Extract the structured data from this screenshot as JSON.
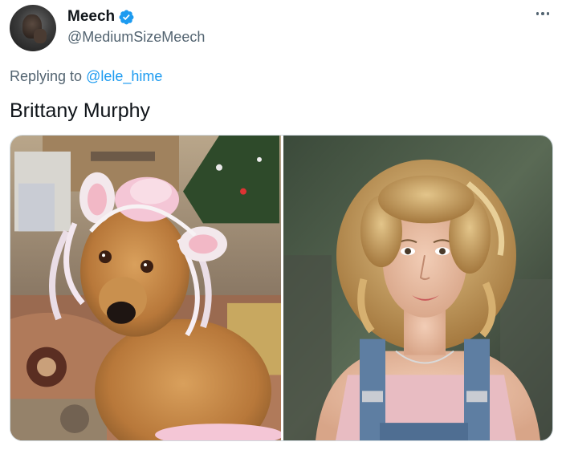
{
  "tweet": {
    "author": {
      "display_name": "Meech",
      "handle": "@MediumSizeMeech",
      "verified": true,
      "avatar_icon": "profile-photo"
    },
    "more_icon": "ellipsis-icon",
    "reply": {
      "prefix": "Replying to",
      "mention": "@lele_hime"
    },
    "text": "Brittany Murphy",
    "media": {
      "count": 2,
      "photos": [
        {
          "subject": "dog-in-costume-photo"
        },
        {
          "subject": "woman-portrait-photo"
        }
      ]
    }
  },
  "colors": {
    "accent": "#1d9bf0",
    "secondary_text": "#536471",
    "primary_text": "#0f1419",
    "border": "#cfd9de"
  }
}
